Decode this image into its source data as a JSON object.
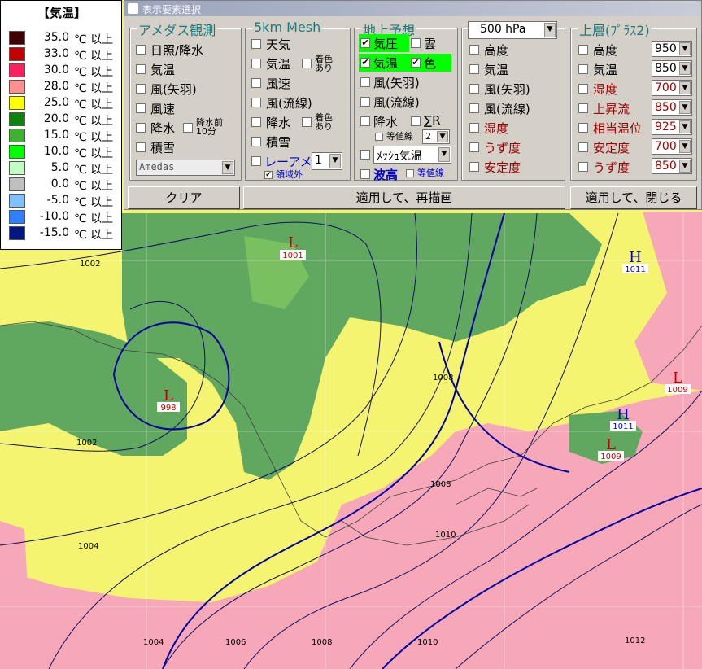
{
  "legend": {
    "title": "【気温】",
    "unit": "℃ 以上",
    "rows": [
      {
        "value": "35.0",
        "color": "#400000"
      },
      {
        "value": "33.0",
        "color": "#c00000"
      },
      {
        "value": "30.0",
        "color": "#ff2060"
      },
      {
        "value": "28.0",
        "color": "#ff9090"
      },
      {
        "value": "25.0",
        "color": "#ffff00"
      },
      {
        "value": "20.0",
        "color": "#108010"
      },
      {
        "value": "15.0",
        "color": "#40b030"
      },
      {
        "value": "10.0",
        "color": "#00ff00"
      },
      {
        "value": "5.0",
        "color": "#c0ffc0"
      },
      {
        "value": "0.0",
        "color": "#c0c0c0"
      },
      {
        "value": "-5.0",
        "color": "#80c0ff"
      },
      {
        "value": "-10.0",
        "color": "#3080ff"
      },
      {
        "value": "-15.0",
        "color": "#001880"
      }
    ]
  },
  "dialog": {
    "title": "表示要素選択",
    "amedas": {
      "title": "アメダス観測",
      "items": [
        "日照/降水",
        "気温",
        "風(矢羽)",
        "風速",
        "降水",
        "積雪"
      ],
      "precip10": "降水前10分",
      "select": "Amedas"
    },
    "mesh": {
      "title": "5km Mesh",
      "items": [
        "天気",
        "気温",
        "風速",
        "風(流線)",
        "降水",
        "積雪"
      ],
      "color1": "着色あり",
      "color2": "着色あり",
      "radar": "レーアメ",
      "radar_value": "1",
      "outside": "領域外"
    },
    "surface": {
      "title": "地上予想",
      "pressure": "気圧",
      "cloud": "雲",
      "temp": "気温",
      "color": "色",
      "items": [
        "風(矢羽)",
        "風(流線)"
      ],
      "precip": "降水",
      "sigma": "∑R",
      "isoline": "等値線",
      "isoline_value": "2",
      "mesh_temp": "ﾒｯｼｭ気温",
      "wave": "波高",
      "wave_iso": "等値線"
    },
    "level500": {
      "select": "500 hPa",
      "items": [
        "高度",
        "気温",
        "風(矢羽)",
        "風(流線)",
        "湿度",
        "うず度",
        "安定度"
      ]
    },
    "upper": {
      "title": "上層(ﾌﾟﾗｽ2)",
      "items": [
        {
          "label": "高度",
          "value": "950"
        },
        {
          "label": "気温",
          "value": "850"
        },
        {
          "label": "湿度",
          "value": "700"
        },
        {
          "label": "上昇流",
          "value": "850"
        },
        {
          "label": "相当温位",
          "value": "925"
        },
        {
          "label": "安定度",
          "value": "700"
        },
        {
          "label": "うず度",
          "value": "850"
        }
      ]
    },
    "buttons": {
      "clear": "クリア",
      "apply": "適用して、再描画",
      "apply_close": "適用して、閉じる"
    }
  },
  "map": {
    "centers": [
      {
        "type": "L",
        "value": "1001"
      },
      {
        "type": "L",
        "value": "998"
      },
      {
        "type": "H",
        "value": "1011"
      },
      {
        "type": "H",
        "value": "1011"
      },
      {
        "type": "L",
        "value": "1009"
      },
      {
        "type": "L",
        "value": "1009"
      }
    ],
    "isobar_labels": [
      "1002",
      "1002",
      "1004",
      "1008",
      "1008",
      "1010",
      "1004",
      "1006",
      "1008",
      "1010",
      "1012"
    ]
  }
}
